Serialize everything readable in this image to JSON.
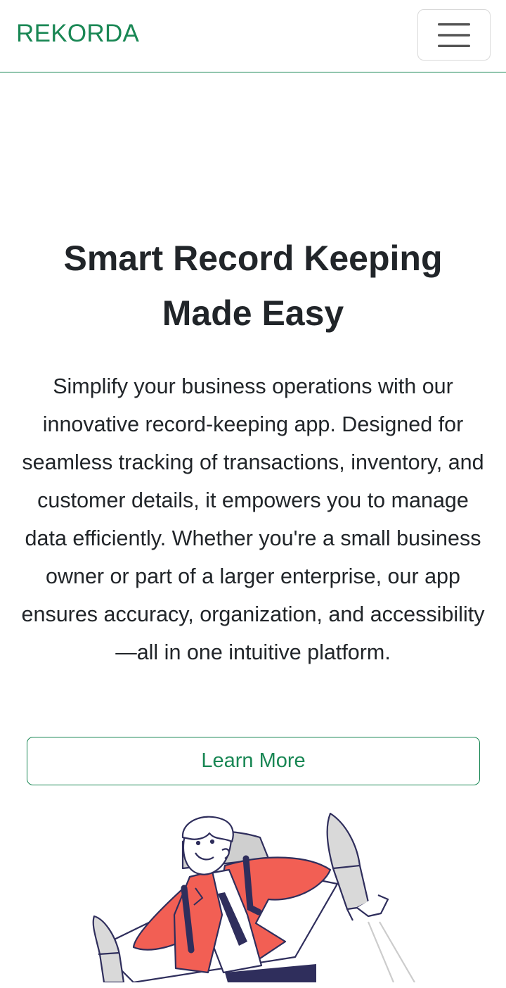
{
  "navbar": {
    "brand": "REKORDA",
    "toggler_icon": "hamburger-menu-icon"
  },
  "hero": {
    "title": "Smart Record Keeping Made Easy",
    "description": "Simplify your business operations with our innovative record-keeping app. Designed for seamless tracking of transactions, inventory, and customer details, it empowers you to manage data efficiently. Whether you're a small business owner or part of a larger enterprise, our app ensures accuracy, organization, and accessibility—all in one intuitive platform.",
    "cta_label": "Learn More",
    "illustration": "businessman-jetpack-illustration"
  },
  "colors": {
    "brand": "#198754",
    "text": "#212529",
    "illustration_accent": "#f25f54",
    "illustration_dark": "#2f2e5c"
  }
}
